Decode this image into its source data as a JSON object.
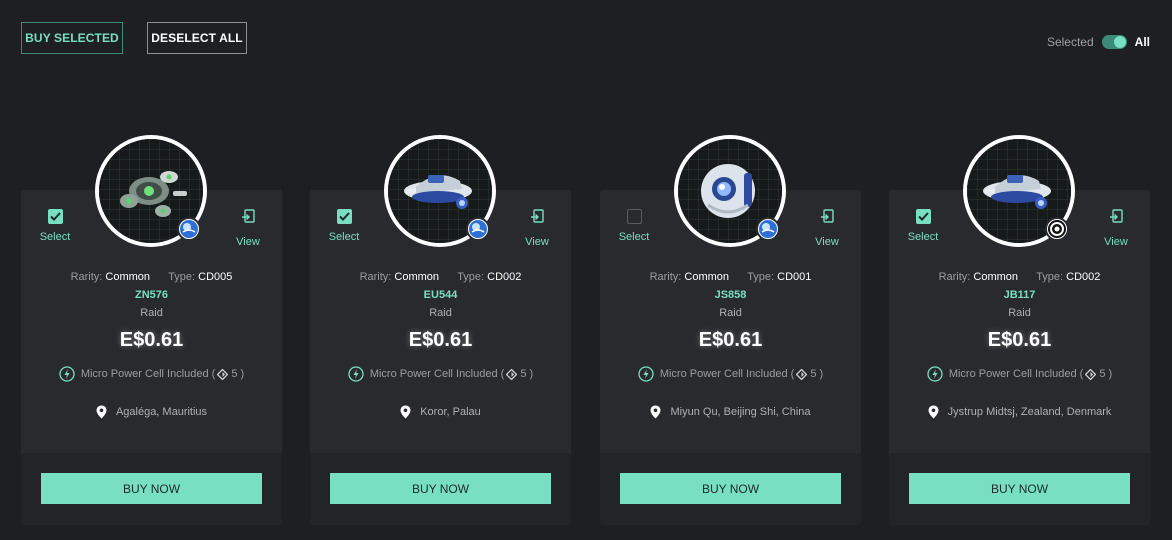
{
  "toolbar": {
    "buy_selected_label": "BUY SELECTED",
    "deselect_all_label": "DESELECT ALL",
    "toggle_left_label": "Selected",
    "toggle_right_label": "All",
    "toggle_on": true
  },
  "colors": {
    "accent": "#78dfc3",
    "background": "#1e1f22",
    "card": "#292a2e"
  },
  "card_labels": {
    "select": "Select",
    "view": "View",
    "rarity_label": "Rarity:",
    "type_label": "Type:",
    "buy_now": "BUY NOW",
    "power_prefix": "Micro Power Cell Included (",
    "power_suffix": ")"
  },
  "cards": [
    {
      "selected": true,
      "select_label": "Select",
      "view_label": "View",
      "rarity": "Common",
      "type": "CD005",
      "code": "ZN576",
      "mode": "Raid",
      "price": "E$0.61",
      "power_text": "Micro Power Cell Included (",
      "power_count": "5 )",
      "location": "Agaléga, Mauritius",
      "image_icon": "green-drone-icon",
      "badge_icon": "globe-badge-icon",
      "buy_label": "BUY NOW"
    },
    {
      "selected": true,
      "select_label": "Select",
      "view_label": "View",
      "rarity": "Common",
      "type": "CD002",
      "code": "EU544",
      "mode": "Raid",
      "price": "E$0.61",
      "power_text": "Micro Power Cell Included (",
      "power_count": "5 )",
      "location": "Koror, Palau",
      "image_icon": "blue-drone-icon",
      "badge_icon": "globe-badge-icon",
      "buy_label": "BUY NOW"
    },
    {
      "selected": false,
      "select_label": "Select",
      "view_label": "View",
      "rarity": "Common",
      "type": "CD001",
      "code": "JS858",
      "mode": "Raid",
      "price": "E$0.61",
      "power_text": "Micro Power Cell Included (",
      "power_count": "5 )",
      "location": "Miyun Qu, Beijing Shi, China",
      "image_icon": "sphere-drone-icon",
      "badge_icon": "globe-badge-icon",
      "buy_label": "BUY NOW"
    },
    {
      "selected": true,
      "select_label": "Select",
      "view_label": "View",
      "rarity": "Common",
      "type": "CD002",
      "code": "JB117",
      "mode": "Raid",
      "price": "E$0.61",
      "power_text": "Micro Power Cell Included (",
      "power_count": "5 )",
      "location": "Jystrup Midtsj, Zealand, Denmark",
      "image_icon": "blue-drone-icon",
      "badge_icon": "ring-badge-icon",
      "buy_label": "BUY NOW"
    }
  ]
}
